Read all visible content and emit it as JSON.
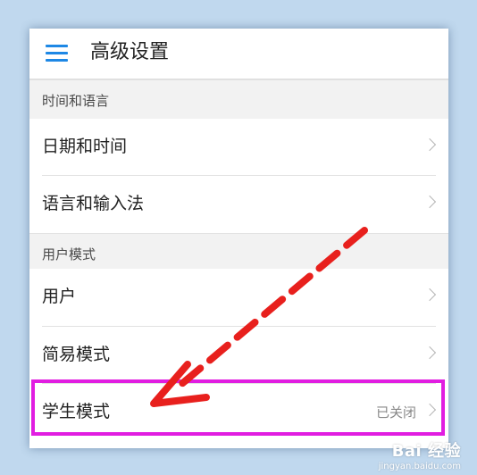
{
  "header": {
    "title": "高级设置"
  },
  "sections": {
    "time_language": {
      "heading": "时间和语言",
      "items": [
        {
          "label": "日期和时间"
        },
        {
          "label": "语言和输入法"
        }
      ]
    },
    "user_mode": {
      "heading": "用户模式",
      "items": [
        {
          "label": "用户"
        },
        {
          "label": "简易模式"
        },
        {
          "label": "学生模式",
          "value": "已关闭"
        }
      ]
    }
  },
  "annotation": {
    "highlight_color": "#e11de1",
    "arrow_color": "#e8201d"
  },
  "watermark": {
    "brand": "Bai 经验",
    "url": "jingyan.baidu.com"
  }
}
